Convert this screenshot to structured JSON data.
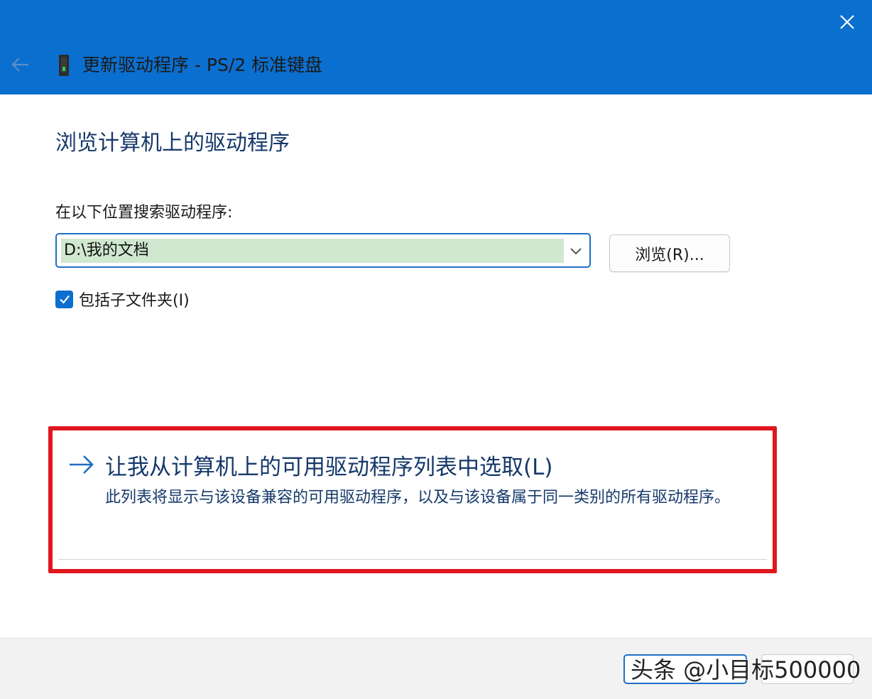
{
  "window": {
    "title": "更新驱动程序 - PS/2 标准键盘",
    "icons": {
      "close": "close-icon",
      "back": "back-arrow-icon",
      "device": "keyboard-device-icon"
    },
    "accent": "#0b6fcf"
  },
  "page": {
    "heading": "浏览计算机上的驱动程序",
    "search_label": "在以下位置搜索驱动程序:",
    "path_value": "D:\\我的文档",
    "browse_label": "浏览(R)...",
    "include_subfolders_label": "包括子文件夹(I)",
    "include_subfolders_checked": true
  },
  "pick_option": {
    "title": "让我从计算机上的可用驱动程序列表中选取(L)",
    "description": "此列表将显示与该设备兼容的可用驱动程序，以及与该设备属于同一类别的所有驱动程序。",
    "highlight_color": "#e0161e"
  },
  "footer": {
    "watermark": "头条 @小目标500000"
  }
}
